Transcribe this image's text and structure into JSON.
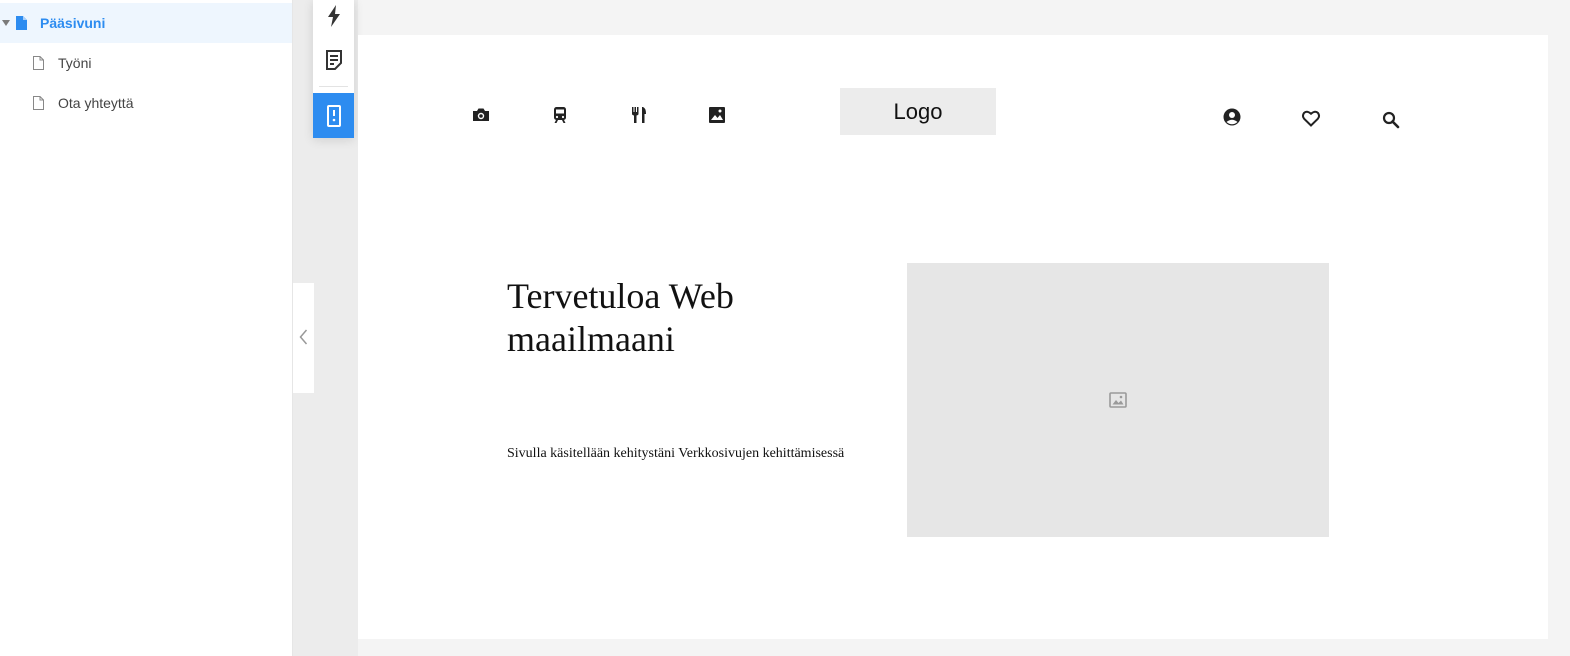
{
  "sidebar": {
    "items": [
      {
        "label": "Pääsivuni",
        "active": true,
        "icon": "document-icon"
      },
      {
        "label": "Työni",
        "active": false,
        "icon": "document-outline-icon"
      },
      {
        "label": "Ota yhteyttä",
        "active": false,
        "icon": "document-outline-icon"
      }
    ]
  },
  "toolbar": {
    "tools": [
      "lightning-icon",
      "note-icon",
      "mobile-icon"
    ],
    "active_tool": "mobile-icon"
  },
  "page": {
    "nav_left_icons": [
      "camera-icon",
      "train-icon",
      "restaurant-icon",
      "image-icon"
    ],
    "logo": "Logo",
    "nav_right_icons": [
      "account-circle-icon",
      "heart-icon",
      "search-icon"
    ],
    "hero": {
      "title": "Tervetuloa Web maailmaani",
      "text": "Sivulla käsitellään kehitystäni Verkkosivujen kehittämisessä",
      "image_icon": "image-placeholder-icon"
    }
  },
  "colors": {
    "accent": "#2d8cf0",
    "active_row_bg": "#eef6fe",
    "placeholder_bg": "#e6e6e6"
  }
}
